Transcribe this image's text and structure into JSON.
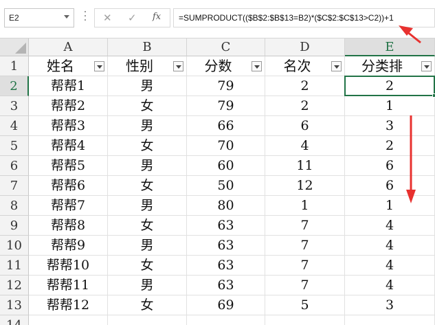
{
  "formula_bar": {
    "name_box": "E2",
    "cancel_glyph": "✕",
    "enter_glyph": "✓",
    "fx_label": "fx",
    "formula": "=SUMPRODUCT(($B$2:$B$13=B2)*($C$2:$C$13>C2))+1"
  },
  "columns": [
    "A",
    "B",
    "C",
    "D",
    "E"
  ],
  "row_numbers": [
    "1",
    "2",
    "3",
    "4",
    "5",
    "6",
    "7",
    "8",
    "9",
    "10",
    "11",
    "12",
    "13",
    "14"
  ],
  "header_row": [
    "姓名",
    "性别",
    "分数",
    "名次",
    "分类排"
  ],
  "rows": [
    [
      "帮帮1",
      "男",
      "79",
      "2",
      "2"
    ],
    [
      "帮帮2",
      "女",
      "79",
      "2",
      "1"
    ],
    [
      "帮帮3",
      "男",
      "66",
      "6",
      "3"
    ],
    [
      "帮帮4",
      "女",
      "70",
      "4",
      "2"
    ],
    [
      "帮帮5",
      "男",
      "60",
      "11",
      "6"
    ],
    [
      "帮帮6",
      "女",
      "50",
      "12",
      "6"
    ],
    [
      "帮帮7",
      "男",
      "80",
      "1",
      "1"
    ],
    [
      "帮帮8",
      "女",
      "63",
      "7",
      "4"
    ],
    [
      "帮帮9",
      "男",
      "63",
      "7",
      "4"
    ],
    [
      "帮帮10",
      "女",
      "63",
      "7",
      "4"
    ],
    [
      "帮帮11",
      "男",
      "63",
      "7",
      "4"
    ],
    [
      "帮帮12",
      "女",
      "69",
      "5",
      "3"
    ]
  ],
  "selected_cell": "E2",
  "colors": {
    "selection": "#217346",
    "annotation_arrow": "#e8312f"
  },
  "icons": [
    "dropdown-arrow-icon",
    "cancel-icon",
    "enter-check-icon",
    "function-fx-icon",
    "filter-dropdown-icon",
    "red-annotation-arrow-icon"
  ]
}
